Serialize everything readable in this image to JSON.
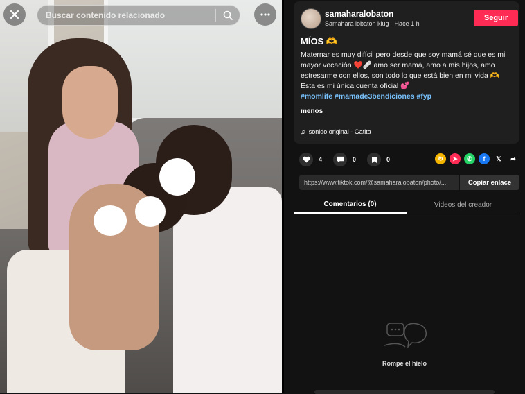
{
  "search": {
    "placeholder": "Buscar contenido relacionado"
  },
  "post": {
    "username": "samaharalobaton",
    "meta": "Samahara lobaton klug · Hace 1 h",
    "follow_label": "Seguir",
    "title": "MÍOS 🫶",
    "description": "Maternar es muy difícil pero desde que soy mamá sé que es mi mayor vocación ❤️🩹 amo ser mamá, amo a mis hijos, amo estresarme con ellos, son todo lo que está bien en mi vida 🫶 Esta es mi única cuenta oficial 💕",
    "hashtags": "#momlife #mamade3bendiciones #fyp",
    "less_label": "menos",
    "sound": "sonido original - Gatita"
  },
  "actions": {
    "likes": "4",
    "comments": "0",
    "saves": "0"
  },
  "share_link": {
    "url": "https://www.tiktok.com/@samaharalobaton/photo/...",
    "copy_label": "Copiar enlace"
  },
  "tabs": [
    {
      "label": "Comentarios (0)"
    },
    {
      "label": "Videos del creador"
    }
  ],
  "empty_state": {
    "text": "Rompe el hielo"
  },
  "colors": {
    "accent": "#fe2c55",
    "hashtag": "#79c3ff",
    "panel_bg": "#121212",
    "card_bg": "#1f1f1f"
  },
  "icons": {
    "close": "close-icon",
    "search": "search-icon",
    "more": "more-icon",
    "like": "heart-icon",
    "comment": "comment-icon",
    "save": "bookmark-icon",
    "music": "music-note-icon"
  }
}
